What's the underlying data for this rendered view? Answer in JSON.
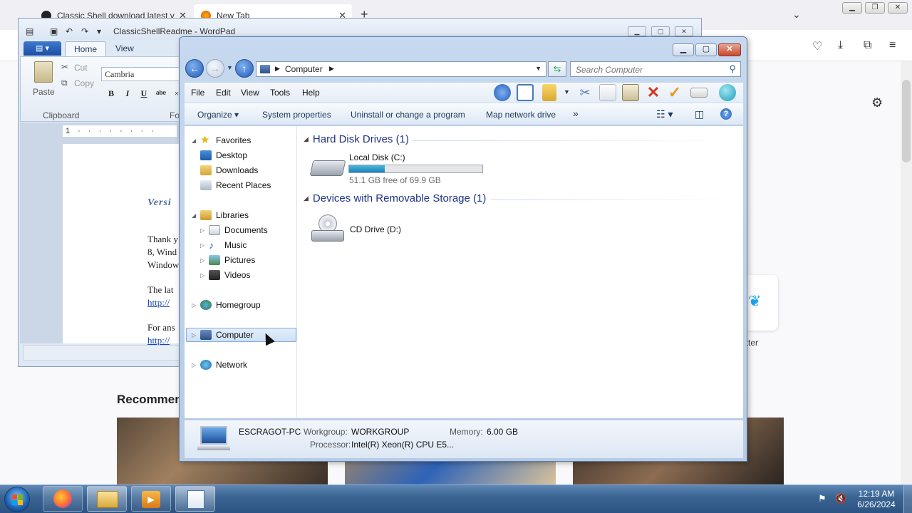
{
  "browser": {
    "tabs": [
      {
        "label": "Classic Shell download latest v"
      },
      {
        "label": "New Tab"
      }
    ],
    "new_tab": "+",
    "recommended": "Recommen",
    "twitter_label": "itter"
  },
  "wordpad": {
    "title": "ClassicShellReadme - WordPad",
    "tabs": [
      "Home",
      "View"
    ],
    "clipboard": {
      "paste": "Paste",
      "cut": "Cut",
      "copy": "Copy",
      "group": "Clipboard"
    },
    "font_group": "Fo",
    "font_name": "Cambria",
    "format_buttons": [
      "B",
      "I",
      "U",
      "abe",
      "×"
    ],
    "ruler": "1 · · · · · · · ·",
    "doc_lines": [
      {
        "text": "Versi",
        "style": "heading"
      },
      {
        "text": "Thank y",
        "style": "normal"
      },
      {
        "text": "8, Wind",
        "style": "normal"
      },
      {
        "text": "Window",
        "style": "normal"
      },
      {
        "text": "The lat",
        "style": "normal"
      },
      {
        "text": "http://",
        "style": "link"
      },
      {
        "text": "For ans",
        "style": "normal"
      },
      {
        "text": "http://",
        "style": "link"
      }
    ]
  },
  "explorer": {
    "address_crumb": "Computer",
    "search_placeholder": "Search Computer",
    "menus": [
      "File",
      "Edit",
      "View",
      "Tools",
      "Help"
    ],
    "commands": [
      "Organize",
      "System properties",
      "Uninstall or change a program",
      "Map network drive"
    ],
    "more_commands": "»",
    "nav": {
      "favorites": {
        "label": "Favorites",
        "items": [
          "Desktop",
          "Downloads",
          "Recent Places"
        ]
      },
      "libraries": {
        "label": "Libraries",
        "items": [
          "Documents",
          "Music",
          "Pictures",
          "Videos"
        ]
      },
      "homegroup": "Homegroup",
      "computer": "Computer",
      "network": "Network"
    },
    "groups": {
      "hdd": {
        "title": "Hard Disk Drives (1)",
        "drive_name": "Local Disk (C:)",
        "free_text": "51.1 GB free of 69.9 GB",
        "used_fraction": 0.27
      },
      "removable": {
        "title": "Devices with Removable Storage (1)",
        "drive_name": "CD Drive (D:)"
      }
    },
    "details": {
      "computer_name": "ESCRAGOT-PC",
      "workgroup_label": "Workgroup:",
      "workgroup": "WORKGROUP",
      "memory_label": "Memory:",
      "memory": "6.00 GB",
      "processor_label": "Processor:",
      "processor": "Intel(R) Xeon(R) CPU E5..."
    }
  },
  "taskbar": {
    "time": "12:19 AM",
    "date": "6/26/2024"
  },
  "colors": {
    "explorer_frame": "#b7cbe5",
    "group_title": "#1e3287",
    "drive_fill": "#1b82b8",
    "taskbar": "#3b6593"
  }
}
